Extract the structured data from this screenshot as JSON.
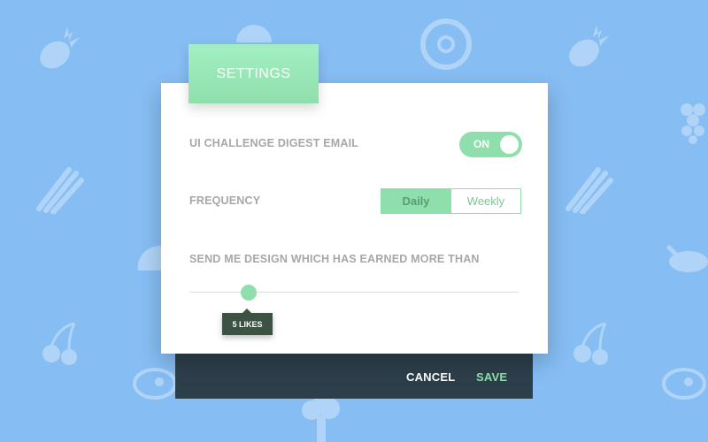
{
  "dialog": {
    "title": "SETTINGS"
  },
  "digest": {
    "label": "UI CHALLENGE DIGEST EMAIL",
    "toggle_text": "ON"
  },
  "frequency": {
    "label": "FREQUENCY",
    "options": [
      "Daily",
      "Weekly"
    ],
    "selected": "Daily"
  },
  "threshold": {
    "label": "SEND ME DESIGN WHICH HAS EARNED MORE THAN",
    "value_text": "5 LIKES",
    "slider_fraction": 0.18
  },
  "footer": {
    "cancel_label": "CANCEL",
    "save_label": "SAVE"
  },
  "colors": {
    "background": "#86bdf3",
    "accent": "#8fdfac",
    "footer": "#2d3f4b",
    "tooltip": "#3c5343"
  },
  "background_icons": [
    "pineapple-icon",
    "watermelon-icon",
    "donut-icon",
    "grapes-icon",
    "asparagus-icon",
    "cherries-icon",
    "turkey-icon",
    "steak-icon",
    "broccoli-icon"
  ]
}
